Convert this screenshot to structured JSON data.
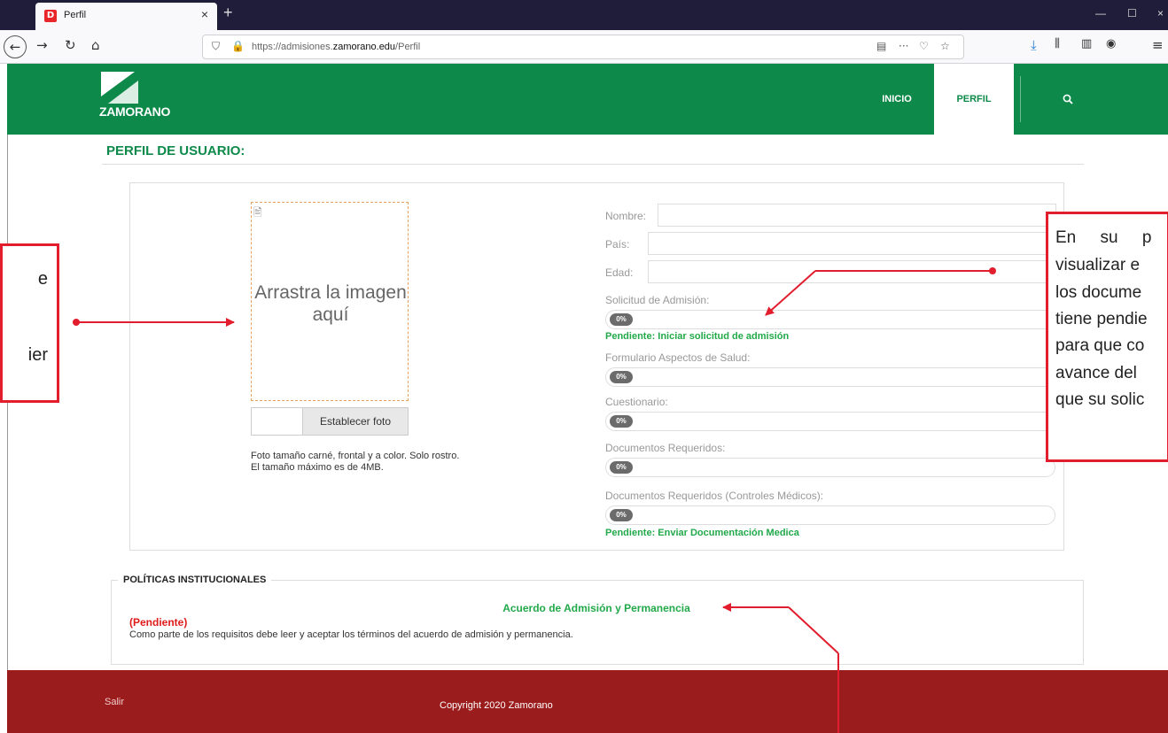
{
  "browser": {
    "tab_title": "Perfil",
    "tab_close": "×",
    "new_tab": "+",
    "url_prefix": "https://admisiones.",
    "url_host": "zamorano.edu",
    "url_path": "/Perfil",
    "icons": [
      "back-icon",
      "forward-icon",
      "reload-icon",
      "home-icon",
      "shield-icon",
      "lock-icon",
      "reader-icon",
      "more-icon",
      "pocket-icon",
      "star-icon",
      "download-icon",
      "library-icon",
      "sidebar-icon",
      "account-icon",
      "menu-icon"
    ]
  },
  "header": {
    "logo_text": "ZAMORANO",
    "menu": [
      {
        "label": "INICIO"
      },
      {
        "label": "PERFIL"
      }
    ]
  },
  "page": {
    "title": "PERFIL DE USUARIO:",
    "photo": {
      "drop_text": "Arrastra la imagen aquí",
      "button": "Establecer foto",
      "note_line1": "Foto tamaño carné, frontal y a color. Solo rostro.",
      "note_line2": "El tamaño máximo es de 4MB."
    },
    "fields": {
      "nombre": "Nombre:",
      "pais": "País:",
      "edad": "Edad:"
    },
    "progress": [
      {
        "label": "Solicitud de Admisión:",
        "value": "0%",
        "percent": 0,
        "status": "Pendiente: Iniciar solicitud de admisión"
      },
      {
        "label": "Formulario Aspectos de Salud:",
        "value": "0%",
        "percent": 0
      },
      {
        "label": "Cuestionario:",
        "value": "0%",
        "percent": 0
      },
      {
        "label": "Documentos Requeridos:",
        "value": "0%",
        "percent": 0
      },
      {
        "label": "Documentos Requeridos (Controles Médicos):",
        "value": "0%",
        "percent": 0,
        "status": "Pendiente: Enviar Documentación Medica"
      }
    ]
  },
  "policies": {
    "legend": "POLÍTICAS INSTITUCIONALES",
    "link": "Acuerdo de Admisión y Permanencia",
    "status": "(Pendiente)",
    "description": "Como parte de los requisitos debe leer y aceptar los términos del acuerdo de admisión y permanencia."
  },
  "footer": {
    "logout": "Salir",
    "copyright": "Copyright 2020 Zamorano"
  },
  "callouts": {
    "left_lines": [
      "e",
      "",
      "",
      "ier"
    ],
    "right_lines": [
      "En su p",
      "visualizar e",
      "los docume",
      "tiene pendie",
      "para que co",
      "avance del",
      "que su solic"
    ]
  },
  "colors": {
    "green": "#0d8a4a",
    "status_green": "#22a94a",
    "footer_red": "#9b1c1c",
    "callout_red": "#e11d2e",
    "pending_red": "#e01b1b"
  }
}
